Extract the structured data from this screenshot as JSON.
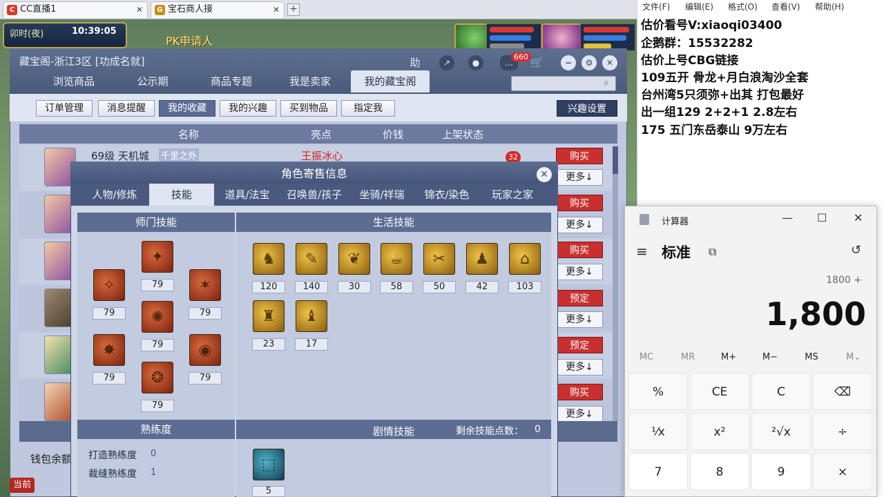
{
  "browser": {
    "tabs": [
      {
        "label": "CC直播1",
        "favicon": "cc"
      },
      {
        "label": "宝石商人接",
        "favicon": "game"
      }
    ],
    "new_tab": "+"
  },
  "game": {
    "time_segment": "卯时(夜)",
    "clock": "10:39:05",
    "pk_label": "PK申请人"
  },
  "cbg": {
    "title": "藏宝阁-浙江3区 [功成名就]",
    "header_help": "助",
    "message_count": "660",
    "nav_tabs": [
      "浏览商品",
      "公示期",
      "商品专题",
      "我是卖家",
      "我的藏宝阁"
    ],
    "active_nav": "我的藏宝阁",
    "sub_buttons": [
      "订单管理",
      "消息提醒",
      "我的收藏",
      "我的兴趣",
      "买到物品",
      "指定我"
    ],
    "active_sub": "我的收藏",
    "interest_settings": "兴趣设置",
    "columns": [
      "名称",
      "亮点",
      "价钱",
      "上架状态"
    ],
    "row1": {
      "name": "69级 天机城",
      "tag": "千里之外",
      "seller": "王振冰心",
      "badge": "32"
    },
    "actions": [
      {
        "primary": "购买",
        "more": "更多↓"
      },
      {
        "primary": "购买",
        "more": "更多↓"
      },
      {
        "primary": "购买",
        "more": "更多↓"
      },
      {
        "primary": "预定",
        "more": "更多↓"
      },
      {
        "primary": "预定",
        "more": "更多↓"
      },
      {
        "primary": "购买",
        "more": "更多↓"
      }
    ],
    "wallet_label": "钱包余额",
    "current_button": "当前"
  },
  "popup": {
    "title": "角色寄售信息",
    "tabs": [
      "人物/修炼",
      "技能",
      "道具/法宝",
      "召唤兽/孩子",
      "坐骑/祥瑞",
      "锦衣/染色",
      "玩家之家"
    ],
    "active_tab": "技能",
    "school_skills_title": "师门技能",
    "school_skills": [
      "79",
      "79",
      "79",
      "79",
      "79",
      "79",
      "79"
    ],
    "life_skills_title": "生活技能",
    "life_skills": [
      "120",
      "140",
      "30",
      "58",
      "50",
      "42",
      "103",
      "23",
      "17"
    ],
    "proficiency_title": "熟练度",
    "proficiency": [
      {
        "label": "打造熟练度",
        "value": "0"
      },
      {
        "label": "裁缝熟练度",
        "value": "1"
      }
    ],
    "story_title": "剧情技能",
    "remaining_points_label": "剩余技能点数：",
    "remaining_points": "0",
    "story_skills": [
      "5"
    ]
  },
  "notepad": {
    "menu": [
      "文件(F)",
      "编辑(E)",
      "格式(O)",
      "查看(V)",
      "帮助(H)"
    ],
    "lines": [
      "估价看号V:xiaoqi03400",
      "企鹅群：15532282",
      "估价上号CBG链接",
      "109五开 骨龙+月白浪淘沙全套",
      "台州湾5只须弥+出其 打包最好",
      "出一组129 2+2+1   2.8左右",
      "175 五门东岳泰山  9万左右"
    ]
  },
  "calculator": {
    "title": "计算器",
    "mode": "标准",
    "expression": "1800 +",
    "display": "1,800",
    "memory": [
      "MC",
      "MR",
      "M+",
      "M−",
      "MS",
      "M⌄"
    ],
    "keys": [
      "%",
      "CE",
      "C",
      "⌫",
      "¹⁄x",
      "x²",
      "²√x",
      "÷",
      "7",
      "8",
      "9",
      "×"
    ]
  },
  "colors": {
    "buy": "#c8302f",
    "header": "#4a5a7a",
    "accent_blue": "#2f3f60"
  }
}
